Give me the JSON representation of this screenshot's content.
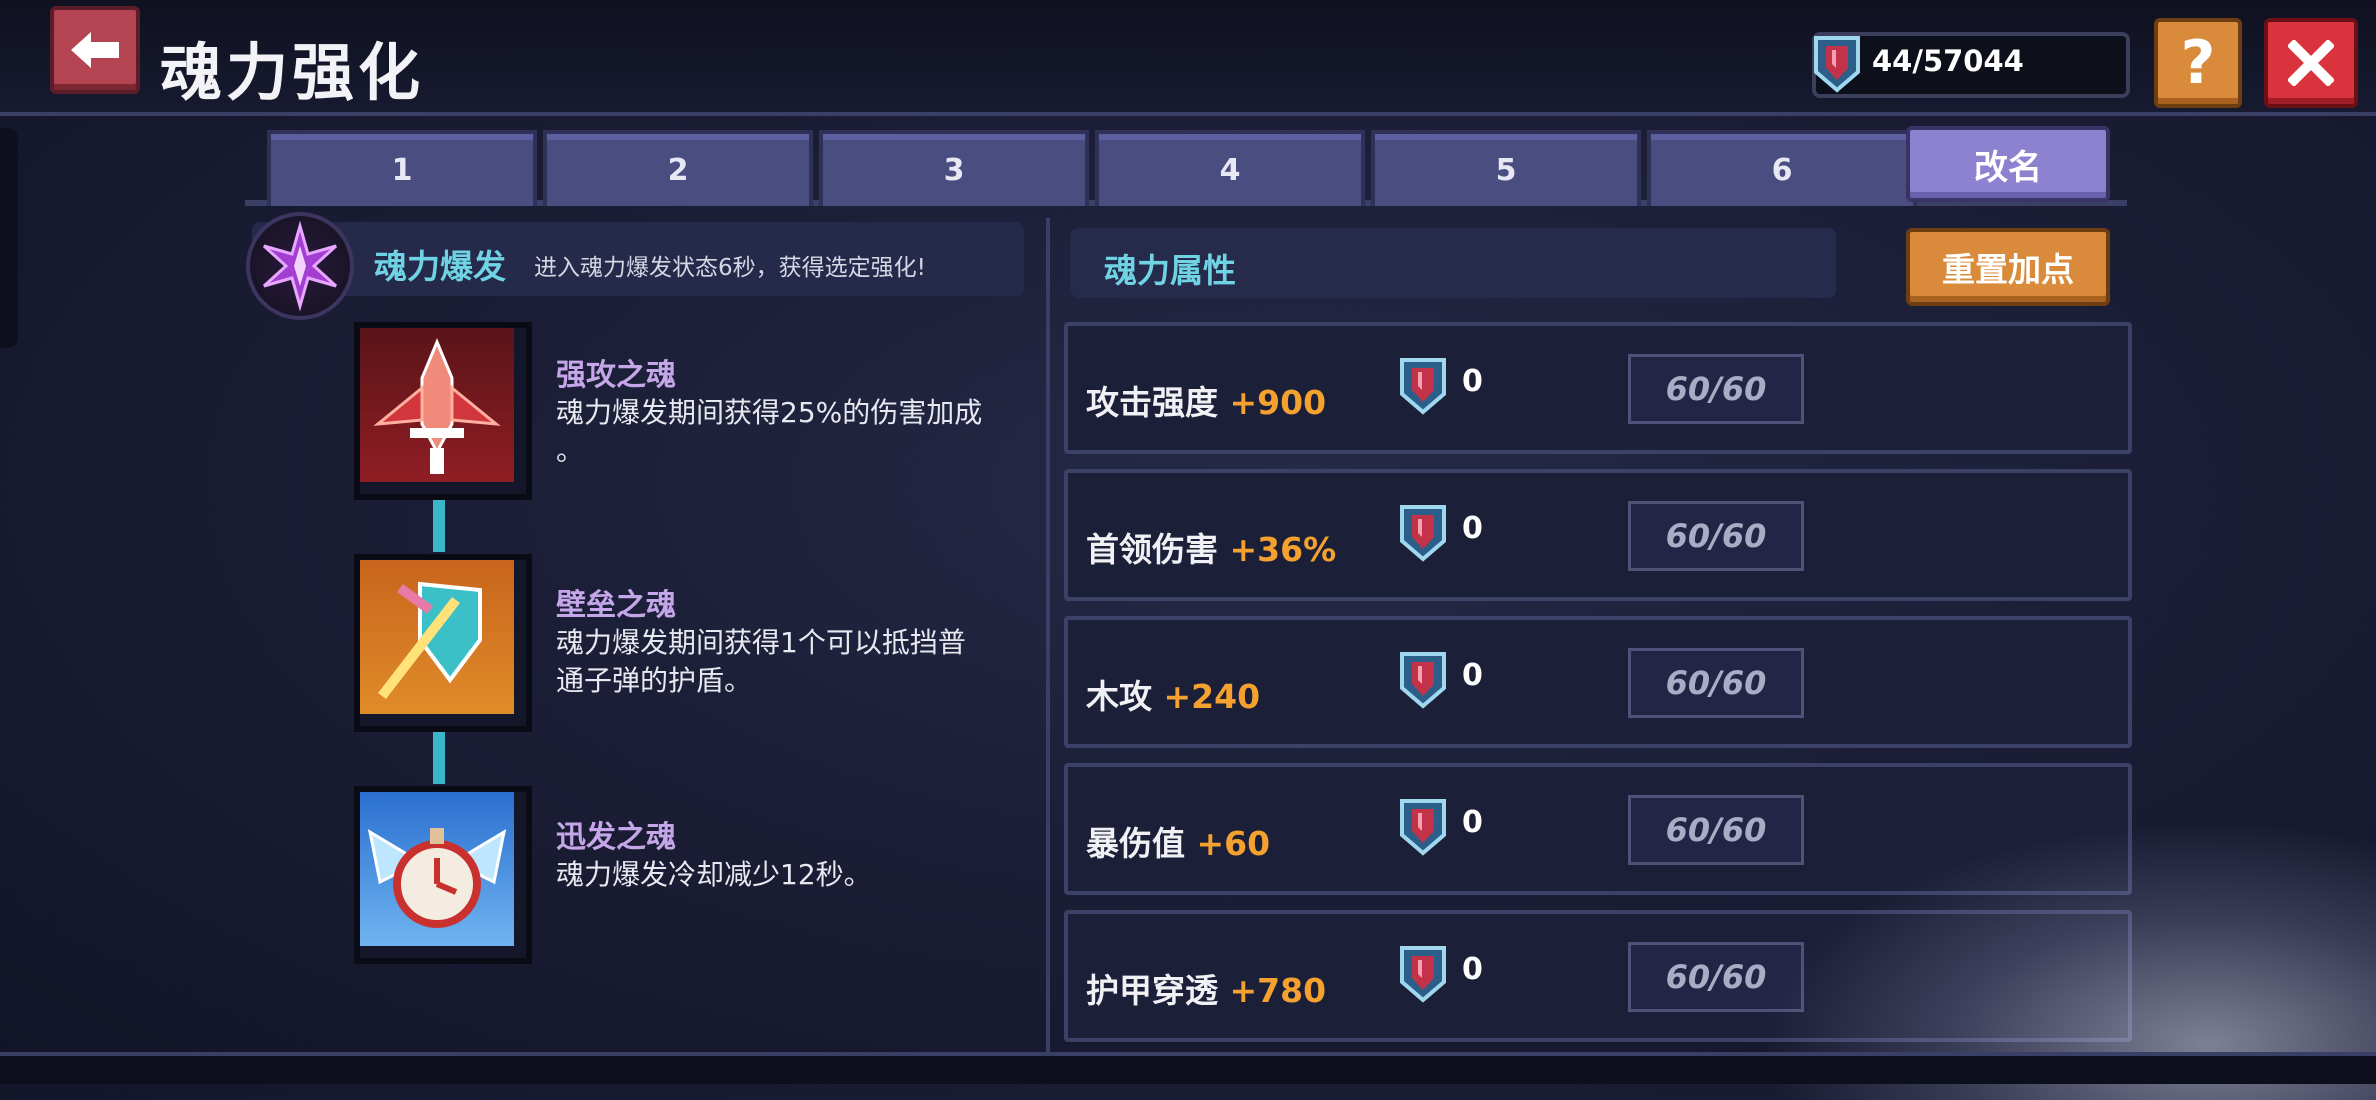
{
  "header": {
    "back_icon": "arrow-left-icon",
    "title": "魂力强化",
    "currency": "44/57044",
    "currency_icon": "soul-crystal-icon",
    "help_label": "?",
    "close_icon": "close-icon"
  },
  "tabs": [
    "1",
    "2",
    "3",
    "4",
    "5",
    "6"
  ],
  "rename_label": "改名",
  "burst": {
    "title": "魂力爆发",
    "description": "进入魂力爆发状态6秒，获得选定强化!",
    "icon": "purple-star-gem-icon"
  },
  "skills": [
    {
      "name": "强攻之魂",
      "desc_line1": "魂力爆发期间获得25%的伤害加成",
      "desc_line2": "。",
      "icon": "red-ship-icon"
    },
    {
      "name": "壁垒之魂",
      "desc_line1": "魂力爆发期间获得1个可以抵挡普",
      "desc_line2": "通子弹的护盾。",
      "icon": "shield-sword-icon"
    },
    {
      "name": "迅发之魂",
      "desc_line1": "魂力爆发冷却减少12秒。",
      "desc_line2": "",
      "icon": "stopwatch-wings-icon"
    }
  ],
  "attributes": {
    "title": "魂力属性",
    "reset_label": "重置加点",
    "rows": [
      {
        "label": "攻击强度",
        "bonus": "+900",
        "points": "0",
        "cap": "60/60"
      },
      {
        "label": "首领伤害",
        "bonus": "+36%",
        "points": "0",
        "cap": "60/60"
      },
      {
        "label": "木攻",
        "bonus": "+240",
        "points": "0",
        "cap": "60/60"
      },
      {
        "label": "暴伤值",
        "bonus": "+60",
        "points": "0",
        "cap": "60/60"
      },
      {
        "label": "护甲穿透",
        "bonus": "+780",
        "points": "0",
        "cap": "60/60"
      }
    ]
  },
  "colors": {
    "accent_cyan": "#6fd3e3",
    "bonus_orange": "#f5a130",
    "skill_name_purple": "#c5a6e9",
    "tab_fill": "#4a4d80"
  }
}
